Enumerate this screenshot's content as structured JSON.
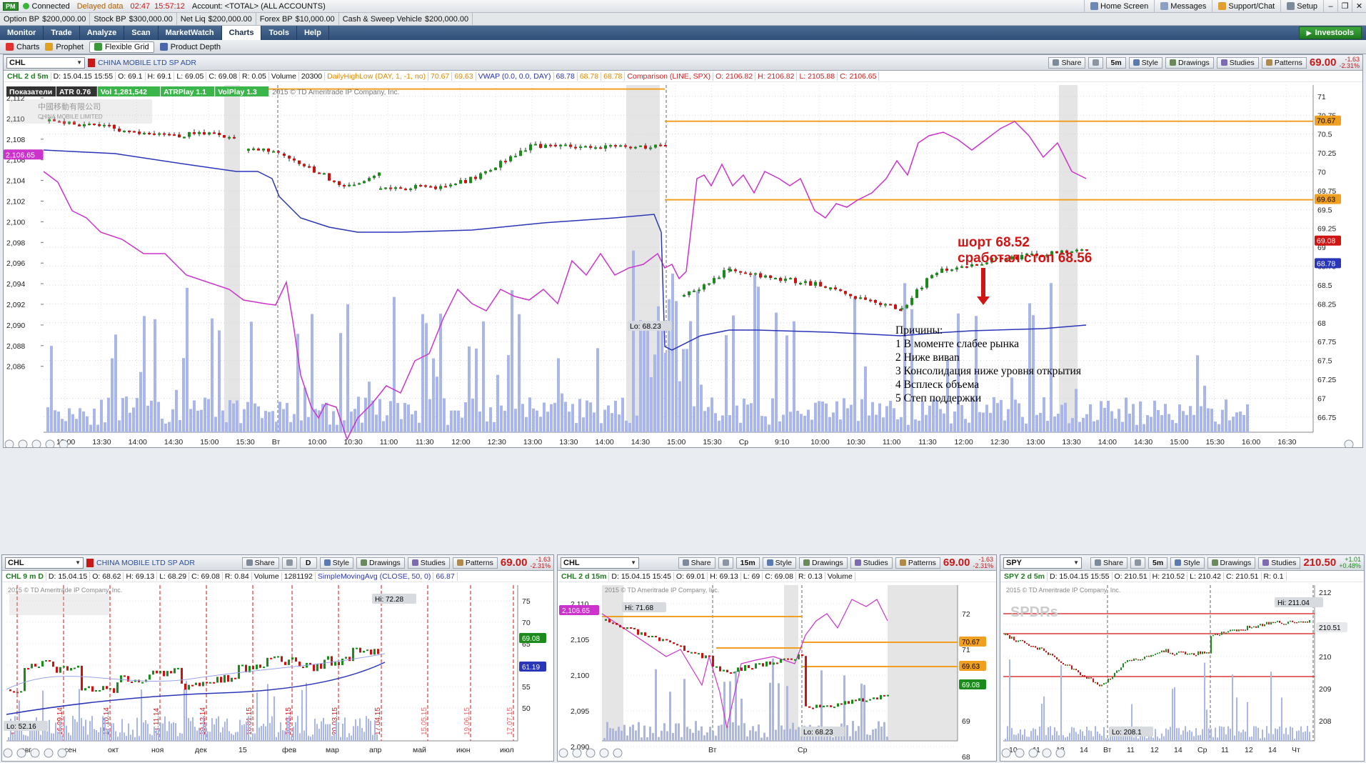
{
  "app": {
    "badge": "PM",
    "connected": "Connected",
    "delayed": "Delayed data",
    "time1": "02:47",
    "time2": "15:57:12",
    "account": "Account: <TOTAL> (ALL ACCOUNTS)",
    "top_buttons": [
      "Home Screen",
      "Messages",
      "Support/Chat",
      "Setup"
    ]
  },
  "balances": [
    {
      "k": "Option BP",
      "v": "$200,000.00"
    },
    {
      "k": "Stock BP",
      "v": "$300,000.00"
    },
    {
      "k": "Net Liq",
      "v": "$200,000.00"
    },
    {
      "k": "Forex BP",
      "v": "$10,000.00"
    },
    {
      "k": "Cash & Sweep Vehicle",
      "v": "$200,000.00"
    }
  ],
  "main_tabs": [
    "Monitor",
    "Trade",
    "Analyze",
    "Scan",
    "MarketWatch",
    "Charts",
    "Tools",
    "Help"
  ],
  "active_tab": "Charts",
  "investools": "Investools",
  "sub_tabs": [
    "Charts",
    "Prophet",
    "Flexible Grid",
    "Product Depth"
  ],
  "active_sub": "Flexible Grid",
  "btn": {
    "share": "Share",
    "style": "Style",
    "drawings": "Drawings",
    "studies": "Studies",
    "patterns": "Patterns"
  },
  "main": {
    "symbol": "CHL",
    "desc": "CHINA MOBILE LTD SP ADR",
    "period": "5m",
    "price": "69.00",
    "chg1": "-1.63",
    "chg2": "-2.31%",
    "info": [
      "CHL 2 d 5m",
      "D: 15.04.15 15:55",
      "O: 69.1",
      "H: 69.1",
      "L: 69.05",
      "C: 69.08",
      "R: 0.05",
      "Volume",
      "20300",
      "DailyHighLow (DAY, 1, -1, no)",
      "70.67",
      "69.63",
      "VWAP (0.0, 0.0, DAY)",
      "68.78",
      "68.78",
      "68.78",
      "Comparison (LINE, SPX)",
      "O: 2106.82",
      "H: 2106.82",
      "L: 2105.88",
      "C: 2106.65"
    ],
    "badges": [
      "Показатели",
      "ATR 0.76",
      "Vol 1,281,542",
      "ATRPlay 1.1",
      "VolPlay 1.3"
    ],
    "copyright": "2015 © TD Ameritrade IP Company, Inc.",
    "logo1": "中國移動有限公司",
    "logo2": "CHINA MOBILE LIMITED",
    "left_ticks": [
      "2,112",
      "2,110",
      "2,108",
      "2,106",
      "2,104",
      "2,102",
      "2,100",
      "2,098",
      "2,096",
      "2,094",
      "2,092",
      "2,090",
      "2,088",
      "2,086"
    ],
    "right_ticks": [
      "71",
      "70.75",
      "70.5",
      "70.25",
      "70",
      "69.75",
      "69.5",
      "69.25",
      "69",
      "68.75",
      "68.5",
      "68.25",
      "68",
      "67.75",
      "67.5",
      "67.25",
      "67",
      "66.75"
    ],
    "x_ticks": [
      "13:00",
      "13:30",
      "14:00",
      "14:30",
      "15:00",
      "15:30",
      "Вт",
      "10:00",
      "10:30",
      "11:00",
      "11:30",
      "12:00",
      "12:30",
      "13:00",
      "13:30",
      "14:00",
      "14:30",
      "15:00",
      "15:30",
      "Ср",
      "9:10",
      "10:00",
      "10:30",
      "11:00",
      "11:30",
      "12:00",
      "12:30",
      "13:00",
      "13:30",
      "14:00",
      "14:30",
      "15:00",
      "15:30",
      "16:00",
      "16:30"
    ],
    "spx_tag": "2,106.65",
    "tag_hi": "70.67",
    "tag_lo": "69.63",
    "tag_last": "69.08",
    "tag_vwap": "68.78",
    "lo_label": "Lo: 68.23",
    "trade1": "шорт 68.52",
    "trade2": "сработал стоп 68.56",
    "reasons": [
      "Причины:",
      "1 В моменте слабее рынка",
      "2 Ниже виваn",
      "3 Консолидация ниже уровня открытия",
      "4 Всплеск объема",
      "5 Степ поддержки"
    ]
  },
  "p1": {
    "symbol": "CHL",
    "desc": "CHINA MOBILE LTD SP ADR",
    "period": "D",
    "price": "69.00",
    "chg1": "-1.63",
    "chg2": "-2.31%",
    "info": [
      "CHL 9 m D",
      "D: 15.04.15",
      "O: 68.62",
      "H: 69.13",
      "L: 68.29",
      "C: 69.08",
      "R: 0.84",
      "Volume",
      "1281192",
      "SimpleMovingAvg (CLOSE, 50, 0)",
      "66.87"
    ],
    "right_ticks": [
      "75",
      "70",
      "65",
      "60",
      "55",
      "50"
    ],
    "x_ticks": [
      "авг",
      "сен",
      "окт",
      "ноя",
      "дек",
      "15",
      "фев",
      "мар",
      "апр",
      "май",
      "июн",
      "июл"
    ],
    "dates": [
      "14",
      "16.09.14",
      "17.10.14",
      "21.11.14",
      "19.12.14",
      "16.01.15",
      "20.02.15",
      "20.03.15",
      "17.04.15",
      "15.05.15",
      "19.06.15",
      "17.07.15"
    ],
    "hi": "Hi: 72.28",
    "lo": "Lo: 52.16",
    "tag1": "69.08",
    "tag2": "61.19"
  },
  "p2": {
    "symbol": "CHL",
    "period": "15m",
    "price": "69.00",
    "chg1": "-1.63",
    "chg2": "-2.31%",
    "info": [
      "CHL 2 d 15m",
      "D: 15.04.15 15:45",
      "O: 69.01",
      "H: 69.13",
      "L: 69",
      "C: 69.08",
      "R: 0.13",
      "Volume"
    ],
    "left_ticks": [
      "2,110",
      "2,105",
      "2,100",
      "2,095",
      "2,090"
    ],
    "right_ticks": [
      "72",
      "71",
      "70",
      "69",
      "68"
    ],
    "x_ticks": [
      "Вт",
      "Ср"
    ],
    "hi": "Hi: 71.68",
    "lo": "Lo: 68.23",
    "spx": "2,106.65",
    "tag1": "70.67",
    "tag2": "69.63",
    "tag3": "69.08"
  },
  "p3": {
    "symbol": "SPY",
    "period": "5m",
    "price": "210.50",
    "chg1": "+1.01",
    "chg2": "+0.48%",
    "info": [
      "SPY 2 d 5m",
      "D: 15.04.15 15:55",
      "O: 210.51",
      "H: 210.52",
      "L: 210.42",
      "C: 210.51",
      "R: 0.1"
    ],
    "right_ticks": [
      "212",
      "211",
      "210",
      "209",
      "208"
    ],
    "x_ticks": [
      "10",
      "11",
      "13",
      "14",
      "Вт",
      "11",
      "12",
      "14",
      "Ср",
      "11",
      "12",
      "14",
      "Чт"
    ],
    "hi": "Hi: 211.04",
    "lo": "Lo: 208.1",
    "tag": "210.51",
    "logo": "SPDRs"
  },
  "colors": {
    "volume": "#a8b6ec",
    "vwap": "#2a36b8",
    "spx": "#cc33cc",
    "level": "#f0a020",
    "up": "#1b8c1b",
    "down": "#cc1111",
    "session": "#e5e5e5",
    "red": "#d01515"
  }
}
